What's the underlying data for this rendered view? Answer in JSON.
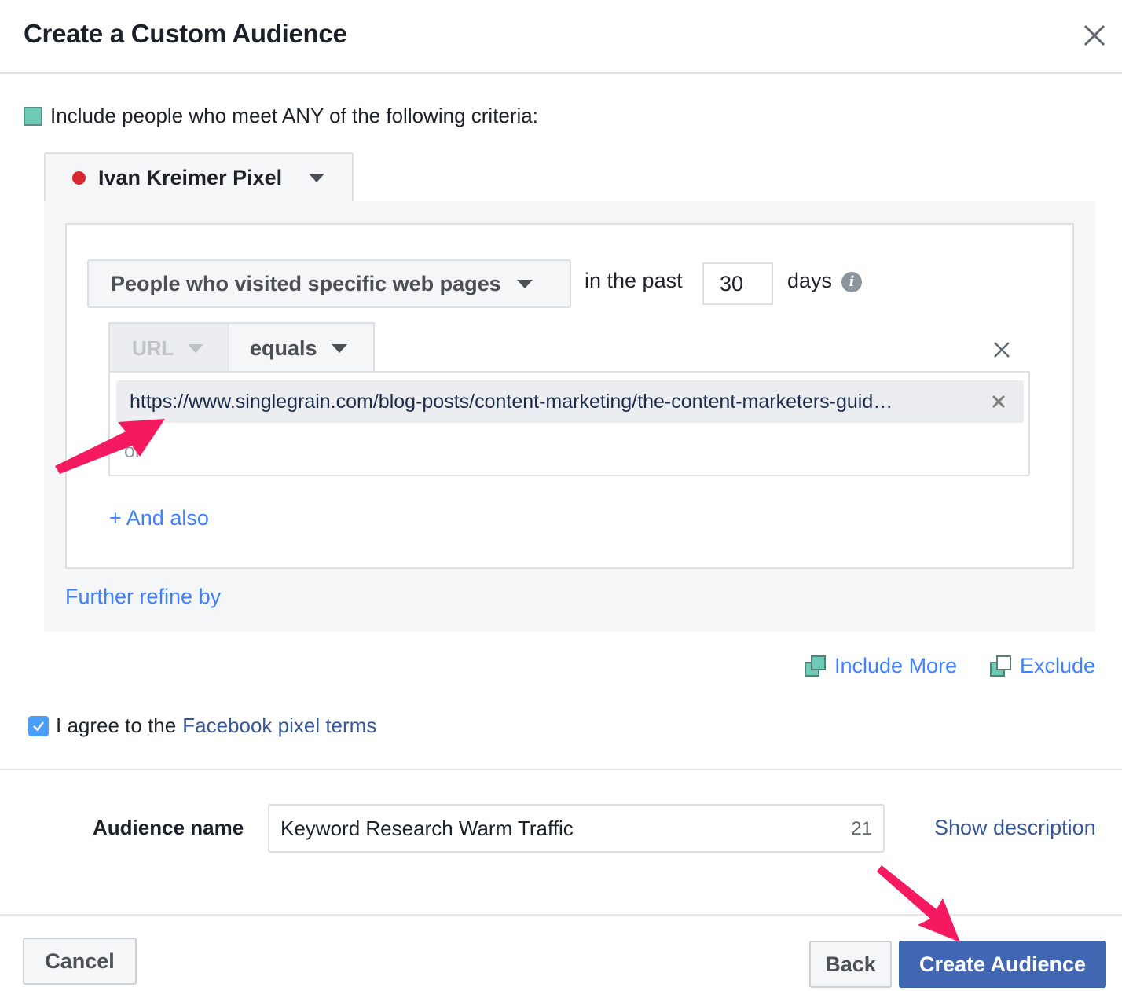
{
  "dialog": {
    "title": "Create a Custom Audience",
    "close_icon": "close-icon"
  },
  "criteria": {
    "label": "Include people who meet ANY of the following criteria:",
    "swatch_color": "#6fcab5"
  },
  "pixel": {
    "name": "Ivan Kreimer Pixel",
    "status_color": "#d9272e"
  },
  "rule": {
    "type_label": "People who visited specific web pages",
    "in_the_past_label": "in the past",
    "days_value": "30",
    "days_label": "days",
    "info_icon": "i",
    "field_label": "URL",
    "operator_label": "equals",
    "url_value": "https://www.singlegrain.com/blog-posts/content-marketing/the-content-marketers-guid…",
    "or_label": "or",
    "and_also_label": "+ And also"
  },
  "refine": {
    "label": "Further refine by"
  },
  "actions": {
    "include_more_label": "Include More",
    "exclude_label": "Exclude"
  },
  "terms": {
    "checked": true,
    "prefix": "I agree to the",
    "link_label": "Facebook pixel terms"
  },
  "audience": {
    "label": "Audience name",
    "value": "Keyword Research Warm Traffic",
    "char_count": "21",
    "show_description_label": "Show description"
  },
  "footer": {
    "cancel_label": "Cancel",
    "back_label": "Back",
    "create_label": "Create Audience"
  },
  "colors": {
    "link_blue": "#4080ff",
    "fb_blue": "#365899",
    "primary_button": "#4267b2",
    "annotation_arrow": "#f5195f"
  }
}
